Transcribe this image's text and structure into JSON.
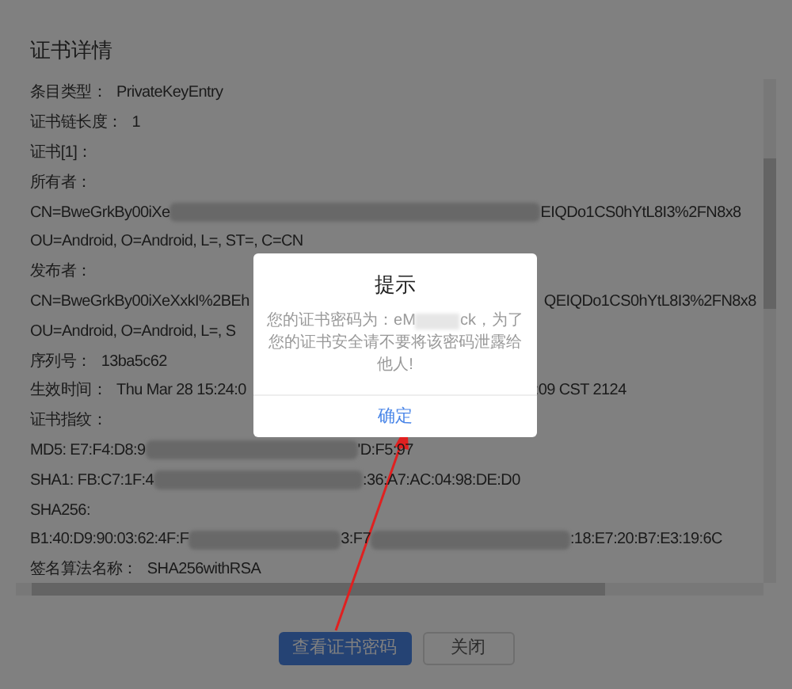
{
  "title": "证书详情",
  "lines": [
    {
      "parts": [
        {
          "kind": "label",
          "text": "条目类型："
        },
        {
          "kind": "text",
          "text": "PrivateKeyEntry"
        }
      ]
    },
    {
      "parts": [
        {
          "kind": "label",
          "text": "证书链长度："
        },
        {
          "kind": "text",
          "text": "1"
        }
      ]
    },
    {
      "parts": [
        {
          "kind": "label",
          "text": "证书[1]："
        }
      ]
    },
    {
      "parts": [
        {
          "kind": "label",
          "text": "所有者："
        }
      ]
    },
    {
      "parts": [
        {
          "kind": "text",
          "text": "CN=BweGrkBy00iXe"
        },
        {
          "kind": "blur"
        },
        {
          "kind": "text",
          "text": "EIQDo1CS0hYtL8I3%2FN8x8"
        }
      ]
    },
    {
      "parts": [
        {
          "kind": "text",
          "text": "OU=Android, O=Android, L=, ST=, C=CN"
        }
      ]
    },
    {
      "parts": [
        {
          "kind": "label",
          "text": "发布者："
        }
      ]
    },
    {
      "parts": [
        {
          "kind": "text",
          "text": "CN=BweGrkBy00iXeXxkI%2BEh"
        },
        {
          "kind": "covered"
        },
        {
          "kind": "text",
          "text": "QEIQDo1CS0hYtL8I3%2FN8x8"
        }
      ]
    },
    {
      "parts": [
        {
          "kind": "text",
          "text": "OU=Android, O=Android, L=, S"
        }
      ]
    },
    {
      "parts": [
        {
          "kind": "label",
          "text": "序列号："
        },
        {
          "kind": "text",
          "text": "13ba5c62"
        }
      ]
    },
    {
      "parts": [
        {
          "kind": "label",
          "text": "生效时间："
        },
        {
          "kind": "text",
          "text": "Thu Mar 28 15:24:0"
        },
        {
          "kind": "covered"
        },
        {
          "kind": "text",
          "text": ":09 CST 2124"
        }
      ]
    },
    {
      "parts": [
        {
          "kind": "label",
          "text": "证书指纹："
        }
      ]
    },
    {
      "parts": [
        {
          "kind": "text",
          "text": "MD5: E7:F4:D8:9"
        },
        {
          "kind": "blur"
        },
        {
          "kind": "text",
          "text": "'D:F5:97"
        }
      ]
    },
    {
      "parts": [
        {
          "kind": "text",
          "text": "SHA1: FB:C7:1F:4"
        },
        {
          "kind": "blur"
        },
        {
          "kind": "text",
          "text": ":36:A7:AC:04:98:DE:D0"
        }
      ]
    },
    {
      "parts": [
        {
          "kind": "text",
          "text": "SHA256:"
        }
      ]
    },
    {
      "parts": [
        {
          "kind": "text",
          "text": "B1:40:D9:90:03:62:4F:F"
        },
        {
          "kind": "blur"
        },
        {
          "kind": "text",
          "text": "3:F7"
        },
        {
          "kind": "blur"
        },
        {
          "kind": "text",
          "text": ":18:E7:20:B7:E3:19:6C"
        }
      ]
    },
    {
      "parts": [
        {
          "kind": "label",
          "text": "签名算法名称："
        },
        {
          "kind": "text",
          "text": "SHA256withRSA"
        }
      ]
    }
  ],
  "buttons": [
    {
      "label": "查看证书密码",
      "kind": "primary"
    },
    {
      "label": "关闭",
      "kind": "default"
    }
  ],
  "dialog": {
    "title": "提示",
    "message": [
      {
        "kind": "text",
        "text": "您的证书密码为：eM"
      },
      {
        "kind": "blur"
      },
      {
        "kind": "text",
        "text": "ck，为了"
      },
      {
        "kind": "break"
      },
      {
        "kind": "text",
        "text": "您的证书安全请不要将该密码泄露给他人!"
      }
    ],
    "confirm": "确定"
  }
}
